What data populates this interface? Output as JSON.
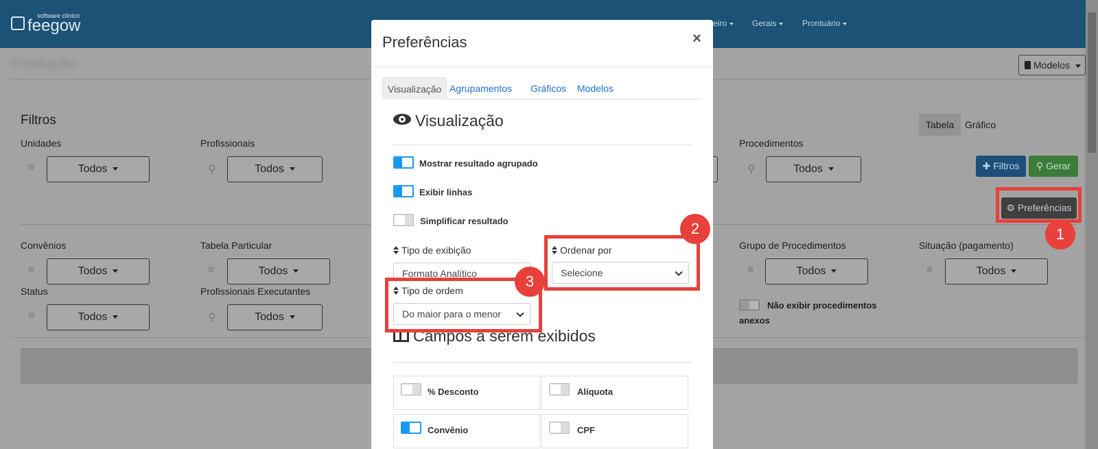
{
  "navbar": {
    "logo_sub": "software clínico",
    "logo_name": "feegow",
    "items": [
      {
        "label": "eiro"
      },
      {
        "label": "Gerais"
      },
      {
        "label": "Prontuário"
      }
    ]
  },
  "page": {
    "title": "Produção",
    "modelos_label": "Modelos",
    "filters_heading": "Filtros",
    "view_switch": {
      "tabela": "Tabela",
      "grafico": "Gráfico"
    },
    "filtros_button": "Filtros",
    "gerar_button": "Gerar",
    "preferencias_button": "Preferências",
    "filters": [
      {
        "label": "Unidades",
        "value": "Todos"
      },
      {
        "label": "Profissionais",
        "value": "Todos"
      },
      {
        "label": "Procedimentos",
        "value": "Todos"
      },
      {
        "label": "Convênios",
        "value": "Todos"
      },
      {
        "label": "Tabela Particular",
        "value": "Todos"
      },
      {
        "label": "Grupo de Procedimentos",
        "value": "Todos"
      },
      {
        "label": "Situação (pagamento)",
        "value": "Todos"
      },
      {
        "label": "Status",
        "value": "Todos"
      },
      {
        "label": "Profissionais Executantes",
        "value": "Todos"
      }
    ],
    "nao_exibir_line1": "Não exibir procedimentos",
    "nao_exibir_line2": "anexos"
  },
  "modal": {
    "title": "Preferências",
    "close": "×",
    "tabs": [
      "Visualização",
      "Agrupamentos",
      "Gráficos",
      "Modelos"
    ],
    "section_visualizacao": "Visualização",
    "toggles": [
      {
        "label": "Mostrar resultado agrupado",
        "on": true
      },
      {
        "label": "Exibir linhas",
        "on": true
      },
      {
        "label": "Simplificar resultado",
        "on": false
      }
    ],
    "tipo_exibicao": {
      "label": "Tipo de exibição",
      "value": "Formato Analítico"
    },
    "ordenar_por": {
      "label": "Ordenar por",
      "value": "Selecione"
    },
    "tipo_ordem": {
      "label": "Tipo de ordem",
      "value": "Do maior para o menor"
    },
    "section_campos": "Campos a serem exibidos",
    "campos": [
      {
        "label": "% Desconto",
        "on": false
      },
      {
        "label": "Alíquota",
        "on": false
      },
      {
        "label": "Convênio",
        "on": true
      },
      {
        "label": "CPF",
        "on": false
      }
    ]
  },
  "annotations": {
    "badge1": "1",
    "badge2": "2",
    "badge3": "3",
    "color": "#e8403a"
  }
}
